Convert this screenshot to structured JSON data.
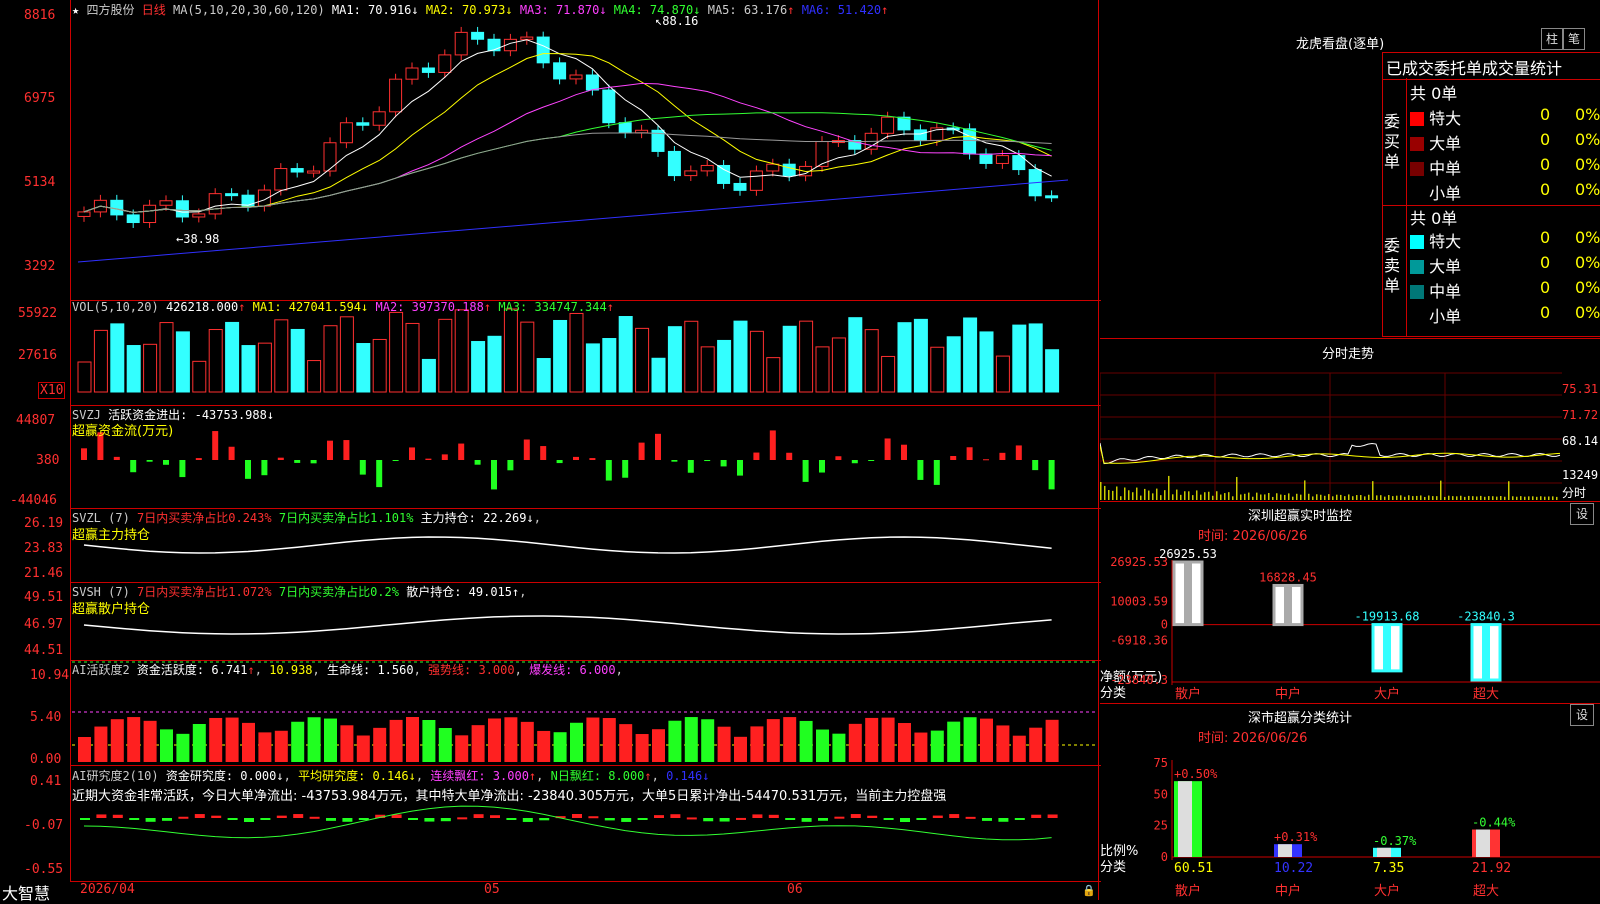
{
  "app": {
    "brand": "大智慧",
    "lock_icon": "lock-icon"
  },
  "kline": {
    "header": {
      "star": "★",
      "stock": "四方股份",
      "period": "日线",
      "ma_params": "MA(5,10,20,30,60,120)",
      "ma1": "MA1: 70.916",
      "ma2": "MA2: 70.973",
      "ma3": "MA3: 71.870",
      "ma4": "MA4: 74.870",
      "ma5": "MA5: 63.176",
      "ma6": "MA6: 51.420",
      "arrows": [
        "↓",
        "↓",
        "↓",
        "↓",
        "↑",
        "↑"
      ]
    },
    "y_ticks": [
      "8816",
      "6975",
      "5134",
      "3292"
    ],
    "high_label": "88.16",
    "low_label": "38.98",
    "x_ticks": [
      "2026/04",
      "05",
      "06"
    ]
  },
  "vol": {
    "label": "VOL(5,10,20)",
    "value": "426218.000",
    "ma1": "MA1: 427041.594",
    "ma2": "MA2: 397370.188",
    "ma3": "MA3: 334747.344",
    "arrows": [
      "↑",
      "↓",
      "↑",
      "↑"
    ],
    "y_ticks": [
      "55922",
      "27616"
    ],
    "unit": "X10"
  },
  "svzj": {
    "label": "SVZJ",
    "title": "活跃资金进出: -43753.988",
    "arrow": "↓",
    "sub": "超赢资金流(万元)",
    "y_ticks": [
      "44807",
      "380",
      "-44046"
    ]
  },
  "svzl": {
    "label": "SVZL (7)",
    "t1": "7日内买卖净占比0.243%",
    "t2": "7日内买卖净占比1.101%",
    "t3": "主力持仓: 22.269",
    "arrow": "↓",
    "sub": "超赢主力持仓",
    "y_ticks": [
      "26.19",
      "23.83",
      "21.46"
    ]
  },
  "svsh": {
    "label": "SVSH (7)",
    "t1": "7日内买卖净占比1.072%",
    "t2": "7日内买卖净占比0.2%",
    "t3": "散户持仓: 49.015",
    "arrow": "↑",
    "sub": "超赢散户持仓",
    "y_ticks": [
      "49.51",
      "46.97",
      "44.51"
    ]
  },
  "ai1": {
    "label": "AI活跃度2",
    "t1": "资金活跃度: 6.741",
    "a1": "↑",
    "t2": "10.938",
    "t3": "生命线: 1.560",
    "t4": "强势线: 3.000",
    "t5": "爆发线: 6.000",
    "y_ticks": [
      "10.94",
      "5.40",
      "0.00"
    ]
  },
  "ai2": {
    "label": "AI研究度2(10)",
    "t1": "资金研究度: 0.000",
    "a1": "↓",
    "t2": "平均研究度: 0.146",
    "a2": "↓",
    "t3": "连续飘红: 3.000",
    "a3": "↑",
    "t4": "N日飘红: 8.000",
    "a4": "↑",
    "t5": "0.146",
    "a5": "↓",
    "comment": "近期大资金非常活跃，今日大单净流出: -43753.984万元，其中特大单净流出: -23840.305万元，大单5日累计净出-54470.531万元，当前主力控盘强",
    "y_ticks": [
      "0.41",
      "-0.07",
      "-0.55"
    ]
  },
  "dragon": {
    "title": "龙虎看盘(逐单)",
    "btn_bar": "柱",
    "btn_pen": "笔",
    "tabs": [
      "已成交",
      "委托单",
      "成交量统计"
    ],
    "buy_side": "委买单",
    "sell_side": "委卖单",
    "buy_total": "共 0单",
    "sell_total": "共 0单",
    "buy_rows": [
      {
        "label": "特大",
        "count": "0",
        "pct": "0%",
        "color": "#ff0000"
      },
      {
        "label": "大单",
        "count": "0",
        "pct": "0%",
        "color": "#990000"
      },
      {
        "label": "中单",
        "count": "0",
        "pct": "0%",
        "color": "#770000"
      },
      {
        "label": "小单",
        "count": "0",
        "pct": "0%",
        "color": "#000000"
      }
    ],
    "sell_rows": [
      {
        "label": "特大",
        "count": "0",
        "pct": "0%",
        "color": "#00ffff"
      },
      {
        "label": "大单",
        "count": "0",
        "pct": "0%",
        "color": "#009999"
      },
      {
        "label": "中单",
        "count": "0",
        "pct": "0%",
        "color": "#007777"
      },
      {
        "label": "小单",
        "count": "0",
        "pct": "0%",
        "color": "#000000"
      }
    ]
  },
  "intraday": {
    "title": "分时走势",
    "y_ticks": [
      "75.31",
      "71.72",
      "68.14"
    ],
    "vol_label": "13249",
    "footer": "分时"
  },
  "monitor": {
    "title": "深圳超赢实时监控",
    "btn": "设",
    "date": "时间: 2026/06/26",
    "y_ticks": [
      "26925.53",
      "10003.59",
      "0",
      "-6918.36",
      "-23840.3"
    ],
    "ylabel": "净额(万元)",
    "xlabel": "分类",
    "categories": [
      "散户",
      "中户",
      "大户",
      "超大"
    ],
    "values": [
      "26925.53",
      "16828.45",
      "-19913.68",
      "-23840.3"
    ]
  },
  "classify": {
    "title": "深市超赢分类统计",
    "btn": "设",
    "date": "时间: 2026/06/26",
    "y_ticks": [
      "75",
      "50",
      "25",
      "0"
    ],
    "ylabel": "比例%",
    "xlabel": "分类",
    "categories": [
      "散户",
      "中户",
      "大户",
      "超大"
    ],
    "values": [
      "60.51",
      "10.22",
      "7.35",
      "21.92"
    ],
    "deltas": [
      "+0.50%",
      "+0.31%",
      "-0.37%",
      "-0.44%"
    ]
  },
  "chart_data": [
    {
      "type": "bar",
      "title": "深圳超赢实时监控",
      "ylabel": "净额(万元)",
      "xlabel": "分类",
      "categories": [
        "散户",
        "中户",
        "大户",
        "超大"
      ],
      "values": [
        26925.53,
        16828.45,
        -19913.68,
        -23840.3
      ],
      "ylim": [
        -23840.3,
        26925.53
      ]
    },
    {
      "type": "bar",
      "title": "深市超赢分类统计",
      "ylabel": "比例%",
      "xlabel": "分类",
      "categories": [
        "散户",
        "中户",
        "大户",
        "超大"
      ],
      "values": [
        60.51,
        10.22,
        7.35,
        21.92
      ],
      "ylim": [
        0,
        75
      ]
    },
    {
      "type": "line",
      "title": "四方股份 日线",
      "ylim": [
        32.92,
        88.16
      ],
      "ma_values": {
        "MA1": 70.916,
        "MA2": 70.973,
        "MA3": 71.87,
        "MA4": 74.87,
        "MA5": 63.176,
        "MA6": 51.42
      },
      "high": 88.16,
      "low": 38.98
    }
  ]
}
